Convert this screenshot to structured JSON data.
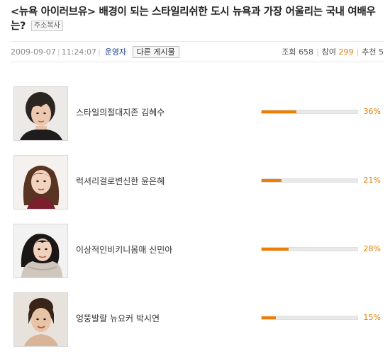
{
  "article": {
    "title": "<뉴욕 아이러브유> 배경이 되는 스타일리쉬한 도시 뉴욕과 가장 어울리는 국내 여배우는?",
    "copy_address_label": "주소복사"
  },
  "meta": {
    "date": "2009-09-07",
    "time": "11:24:07",
    "author": "운영자",
    "other_posts_label": "다른 게시물",
    "views_label": "조회",
    "views": "658",
    "participants_label": "참여",
    "participants": "299",
    "recommend_label": "추천",
    "recommend": "5"
  },
  "poll": {
    "accent_color": "#f07d00",
    "items": [
      {
        "label": "스타일의절대지존 김혜수",
        "percent": 36,
        "percent_text": "36%",
        "icon": "portrait-short-hair"
      },
      {
        "label": "럭셔리걸로변신한 윤은혜",
        "percent": 21,
        "percent_text": "21%",
        "icon": "portrait-long-hair"
      },
      {
        "label": "이상적인비키니몸매 신민아",
        "percent": 28,
        "percent_text": "28%",
        "icon": "portrait-scarf"
      },
      {
        "label": "엉뚱발랄 뉴요커 박시연",
        "percent": 15,
        "percent_text": "15%",
        "icon": "portrait-updo"
      }
    ]
  }
}
